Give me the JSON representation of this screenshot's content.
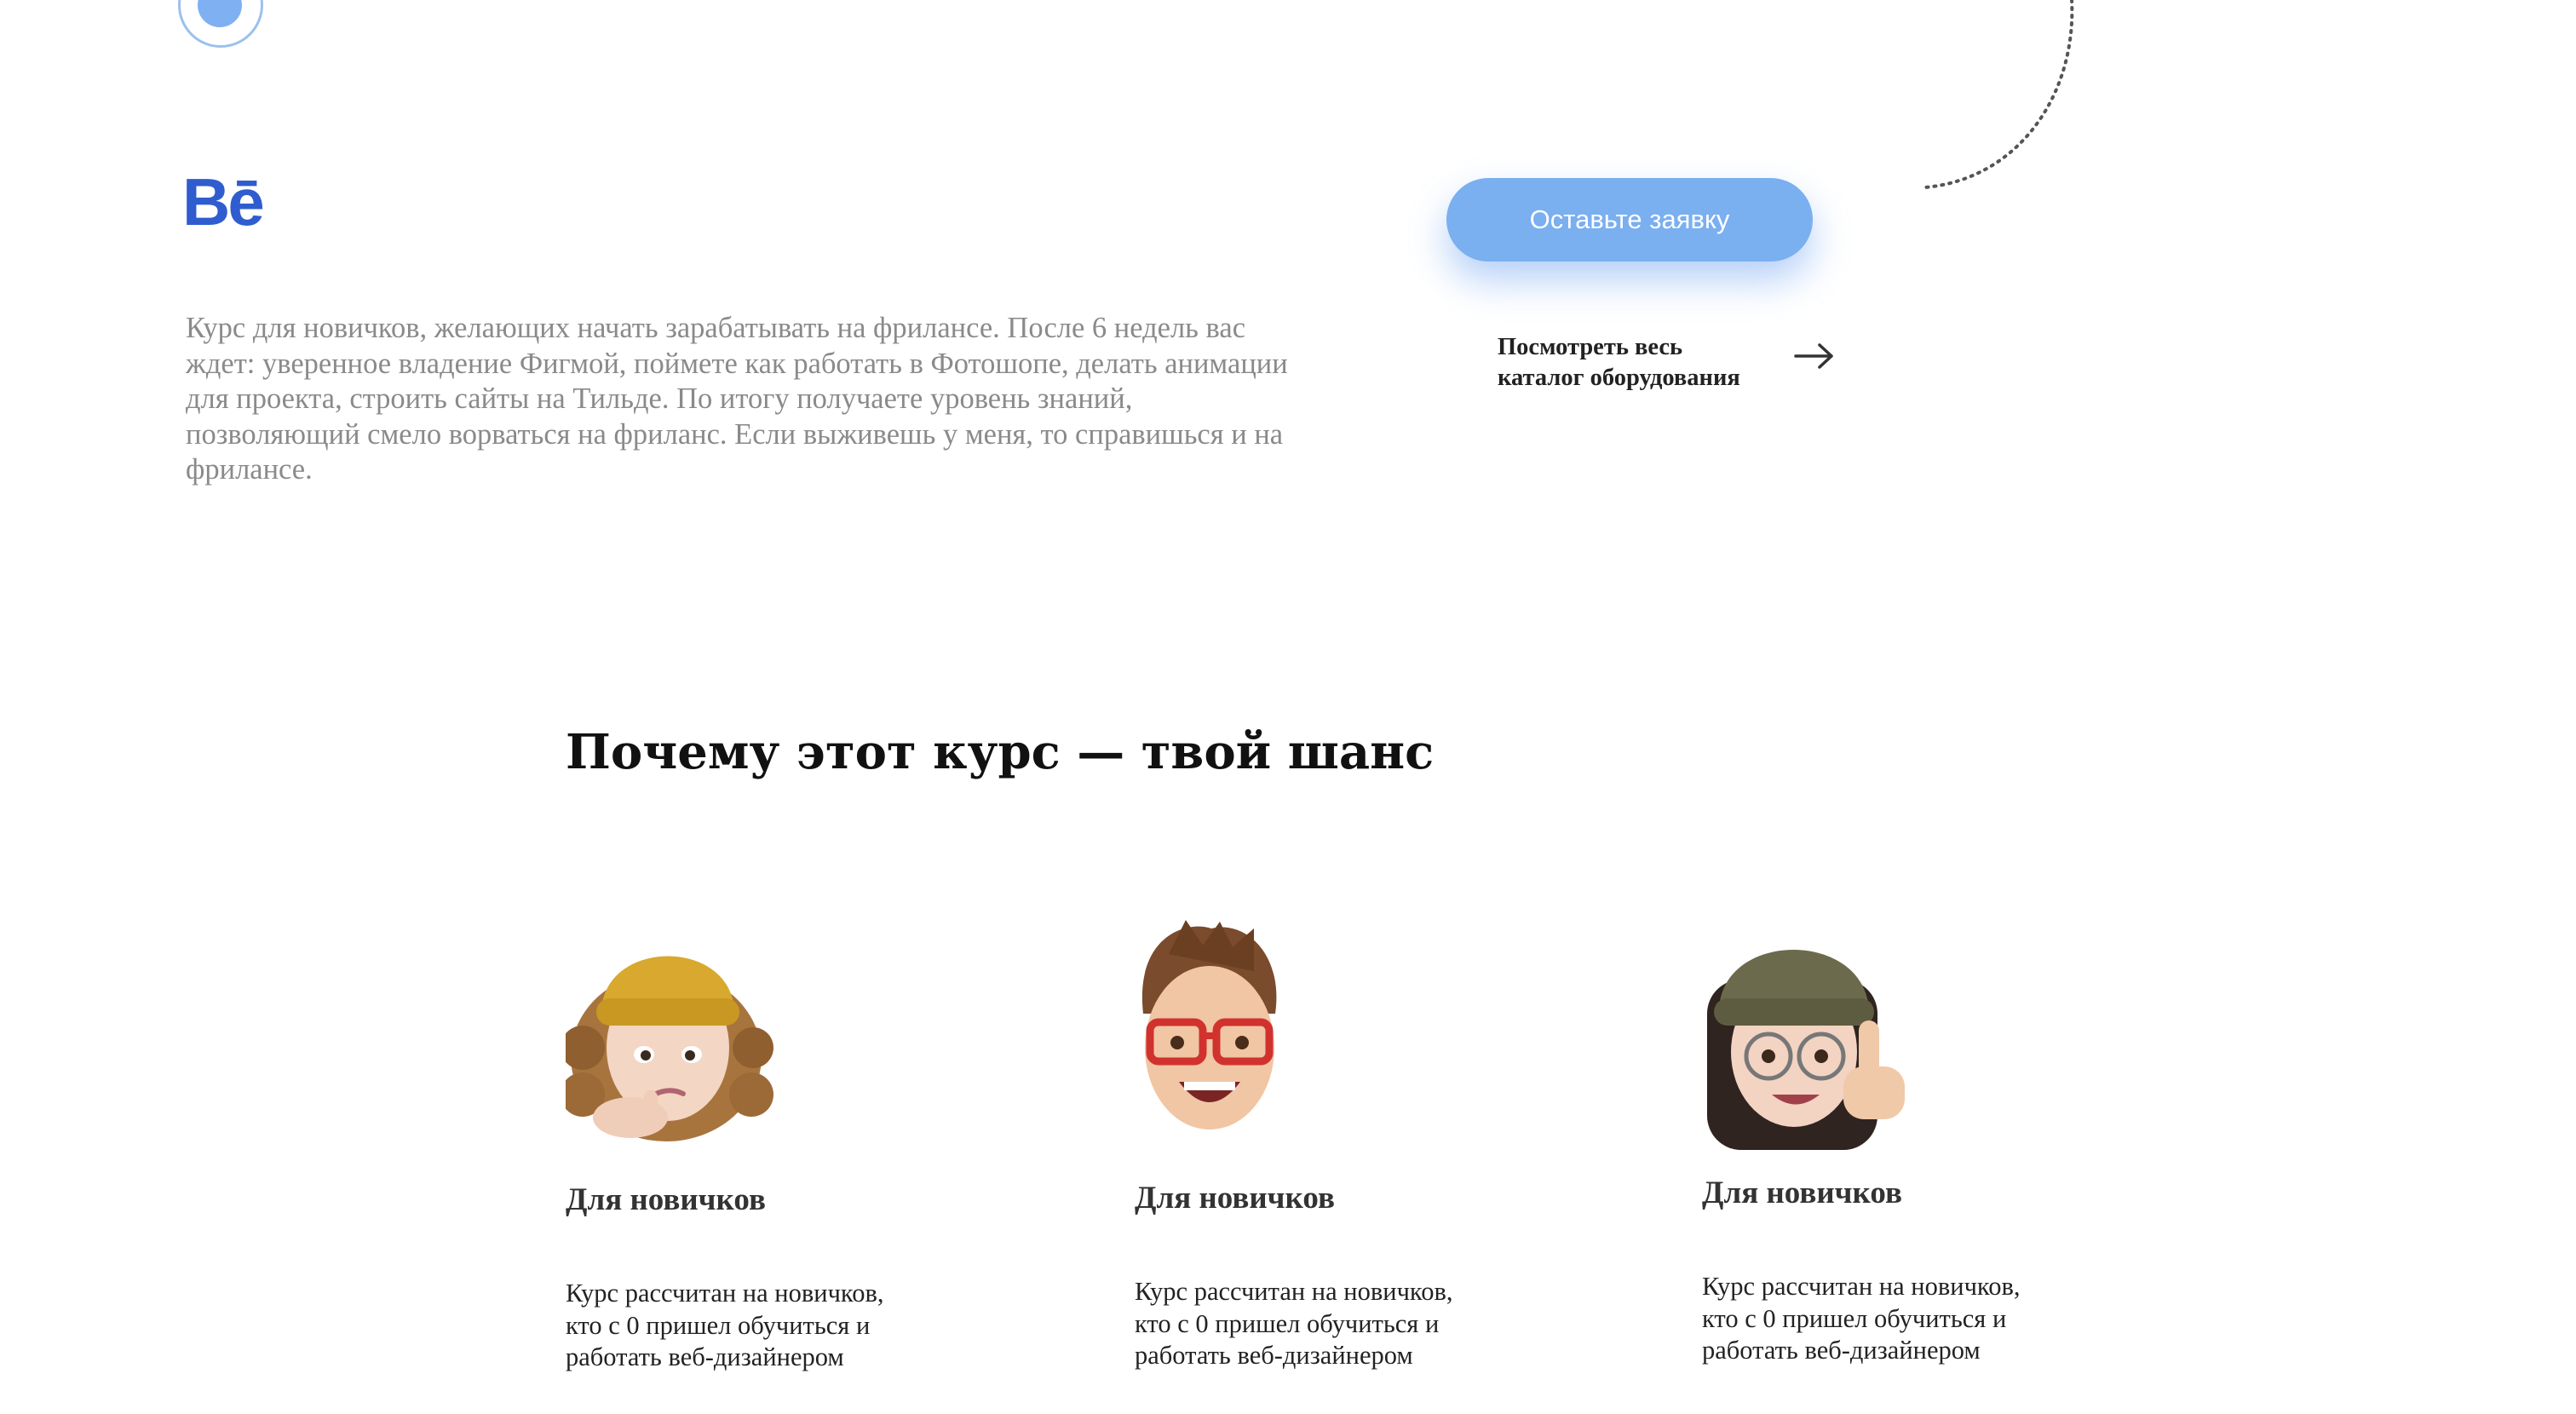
{
  "brand": {
    "logo_text": "Bē"
  },
  "hero": {
    "description": "Курс для новичков, желающих начать зарабатывать на фрилансе. После 6 недель вас ждет: уверенное владение Фигмой, поймете как работать в Фотошопе, делать анимации для проекта, строить сайты на Тильде. По итогу получаете уровень знаний, позволяющий смело ворваться на фриланс. Если выживешь у меня, то справишься и на фрилансе.",
    "cta_label": "Оставьте заявку",
    "catalog_line1": "Посмотреть весь",
    "catalog_line2": "каталог оборудования",
    "catalog_icon": "arrow-right-icon"
  },
  "why": {
    "title": "Почему этот курс — твой шанс",
    "cards": [
      {
        "avatar": "memoji-curly-hair-yellow-beanie",
        "title": "Для новичков",
        "text": "Курс рассчитан на новичков, кто с 0 пришел обучиться и работать веб-дизайнером"
      },
      {
        "avatar": "memoji-red-glasses-smiling",
        "title": "Для новичков",
        "text": "Курс рассчитан на новичков, кто с 0 пришел обучиться и работать веб-дизайнером"
      },
      {
        "avatar": "memoji-olive-beanie-thumbs-up",
        "title": "Для новичков",
        "text": "Курс рассчитан на новичков, кто с 0 пришел обучиться и работать веб-дизайнером"
      }
    ]
  },
  "colors": {
    "accent": "#7aaff0",
    "behance": "#2f5dcf",
    "muted_text": "#8a8a8a"
  }
}
